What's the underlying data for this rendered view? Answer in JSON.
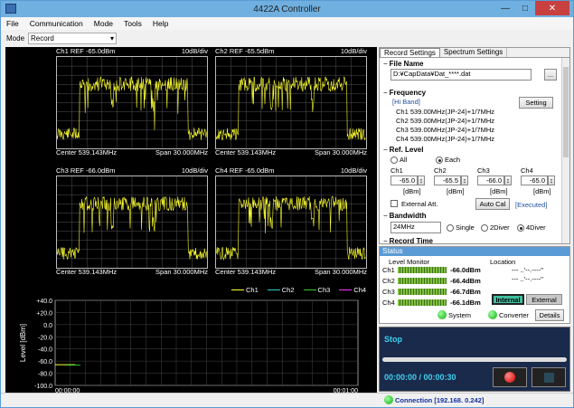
{
  "window": {
    "title": "4422A Controller",
    "minimize": "—",
    "maximize": "□",
    "close": "✕"
  },
  "menu": [
    "File",
    "Communication",
    "Mode",
    "Tools",
    "Help"
  ],
  "mode": {
    "label": "Mode",
    "value": "Record"
  },
  "spectra": [
    {
      "ch": "Ch1",
      "ref": "REF -65.0dBm",
      "div": "10dB/div",
      "center": "Center  539.143MHz",
      "span": "Span   30.000MHz"
    },
    {
      "ch": "Ch2",
      "ref": "REF -65.5dBm",
      "div": "10dB/div",
      "center": "Center  539.143MHz",
      "span": "Span   30.000MHz"
    },
    {
      "ch": "Ch3",
      "ref": "REF -66.0dBm",
      "div": "10dB/div",
      "center": "Center  539.143MHz",
      "span": "Span   30.000MHz"
    },
    {
      "ch": "Ch4",
      "ref": "REF -65.0dBm",
      "div": "10dB/div",
      "center": "Center  539.143MHz",
      "span": "Span   30.000MHz"
    }
  ],
  "legend": [
    {
      "name": "Ch1",
      "color": "#ffff33"
    },
    {
      "name": "Ch2",
      "color": "#33cccc"
    },
    {
      "name": "Ch3",
      "color": "#33cc33"
    },
    {
      "name": "Ch4",
      "color": "#ff33ff"
    }
  ],
  "chart_data": {
    "type": "line",
    "ylabel": "Level [dBm]",
    "yticks": [
      "+40.0",
      "+20.0",
      "0.0",
      "-20.0",
      "-40.0",
      "-60.0",
      "-80.0",
      "-100.0"
    ],
    "ylim": [
      -100,
      40
    ],
    "xticks": [
      "00:00:00",
      "00:01:00"
    ],
    "series": [
      {
        "name": "Ch1",
        "color": "#ffff33",
        "x": [
          0.0,
          4.0
        ],
        "y": [
          -66.0,
          -66.0
        ]
      },
      {
        "name": "Ch3",
        "color": "#33cc33",
        "x": [
          2.0,
          5.0
        ],
        "y": [
          -66.7,
          -66.7
        ]
      }
    ],
    "grid": true
  },
  "settings": {
    "tabs": [
      "Record Settings",
      "Spectrum Settings"
    ],
    "file_name_title": "File Name",
    "file_name": "D:¥CapData¥Dat_****.dat",
    "browse": "...",
    "frequency_title": "Frequency",
    "band": "[Hi Band]",
    "setting_btn": "Setting",
    "freqs": [
      "Ch1   539.00MHz(JP-24)+1/7MHz",
      "Ch2   539.00MHz(JP-24)+1/7MHz",
      "Ch3   539.00MHz(JP-24)+1/7MHz",
      "Ch4   539.00MHz(JP-24)+1/7MHz"
    ],
    "ref_title": "Ref. Level",
    "all": "All",
    "each": "Each",
    "ch_labels": [
      "Ch1",
      "Ch2",
      "Ch3",
      "Ch4"
    ],
    "ref_values": [
      "-65.0",
      "-65.5",
      "-66.0",
      "-65.0"
    ],
    "unit": "[dBm]",
    "external_att": "External Att.",
    "auto_cal": "Auto Cal",
    "executed": "[Executed]",
    "bandwidth_title": "Bandwidth",
    "bandwidth": "24MHz",
    "single": "Single",
    "diver2": "2Diver",
    "diver4": "4Diver",
    "record_time": "Record Time"
  },
  "status": {
    "title": "Status",
    "level_monitor": "Level Monitor",
    "location": "Location",
    "channels": [
      "Ch1",
      "Ch2",
      "Ch3",
      "Ch4"
    ],
    "levels": [
      "-66.0dBm",
      "-66.4dBm",
      "-66.7dBm",
      "-66.1dBm"
    ],
    "loc1": "--- ..'--.----\"",
    "loc2": "--- ..'--.----\"",
    "internal": "Internal",
    "external": "External",
    "system": "System",
    "converter": "Converter",
    "details": "Details"
  },
  "recorder": {
    "state": "Stop",
    "time": "00:00:00  /  00:00:30"
  },
  "statusbar": {
    "connection": "Connection [192.168.  0.242]"
  }
}
